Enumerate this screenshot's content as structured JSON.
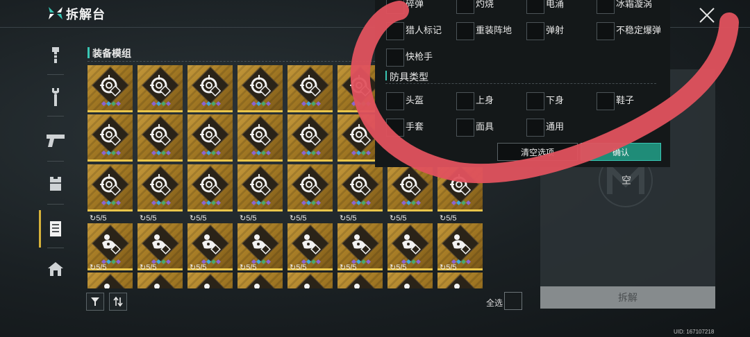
{
  "header": {
    "title": "拆解台",
    "logo_icon": "crossed-x-logo-icon"
  },
  "sidebar": {
    "items": [
      {
        "icon": "bolt-icon"
      },
      {
        "icon": "wrench-icon"
      },
      {
        "icon": "pistol-icon"
      },
      {
        "icon": "armor-vest-icon"
      },
      {
        "icon": "module-card-icon",
        "active": true
      },
      {
        "icon": "home-icon"
      }
    ]
  },
  "section": {
    "title": "装备模组"
  },
  "grid": {
    "rows": [
      {
        "icon": "target-module-icon",
        "count": "",
        "cards": 8
      },
      {
        "icon": "target-module-icon",
        "count": "",
        "cards": 8
      },
      {
        "icon": "target-module-icon",
        "count": "",
        "cards": 8
      },
      {
        "icon": "cluster-module-icon",
        "count": "5/5",
        "cards": 8
      },
      {
        "icon": "cluster-module-icon",
        "count": "5/5",
        "cards": 8
      }
    ],
    "gem_colors": [
      "#8a63d2",
      "#3fa9d8",
      "#4aa86a"
    ]
  },
  "tools": {
    "filter_icon": "filter-icon",
    "sort_icon": "sort-icon",
    "select_all_label": "全选"
  },
  "right_panel": {
    "empty_text": "空",
    "dismantle_label": "拆解"
  },
  "filter_popup": {
    "effect_options": [
      [
        "碎弹",
        "灼烧",
        "电涌",
        "冰霜漩涡"
      ],
      [
        "猎人标记",
        "重装阵地",
        "弹射",
        "不稳定爆弹"
      ],
      [
        "快枪手"
      ]
    ],
    "armor_title": "防具类型",
    "armor_options": [
      [
        "头盔",
        "上身",
        "下身",
        "鞋子"
      ],
      [
        "手套",
        "面具",
        "通用"
      ]
    ],
    "clear_label": "清空选项",
    "confirm_label": "确认"
  },
  "uid": "UID: 167107218",
  "colors": {
    "accent_teal": "#39c6b4",
    "gold": "#c69a3c",
    "scribble": "#e0525e"
  }
}
